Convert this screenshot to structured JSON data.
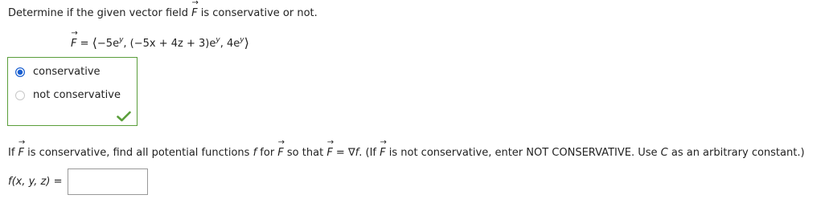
{
  "question": {
    "prefix": "Determine if the given vector field ",
    "vector_symbol": "F",
    "suffix": " is conservative or not."
  },
  "equation": {
    "lhs": "F",
    "equals": " = ",
    "open": "⟨",
    "term1_base": "−5e",
    "term1_exp": "y",
    "sep1": ", ",
    "term2_base": "(−5x + 4z + 3)e",
    "term2_exp": "y",
    "sep2": ", ",
    "term3_base": "4e",
    "term3_exp": "y",
    "close": "⟩"
  },
  "choices": [
    {
      "label": "conservative",
      "selected": true
    },
    {
      "label": "not conservative",
      "selected": false
    }
  ],
  "feedback": {
    "icon": "checkmark-icon",
    "color": "#5a9e3a"
  },
  "instruction": {
    "part1": "If ",
    "part2": " is conservative, find all potential functions ",
    "f1": "f",
    "part3": " for ",
    "part4": " so that ",
    "part5": " = ∇",
    "f2": "f",
    "part6": ". (If ",
    "part7": " is not conservative, enter NOT CONSERVATIVE. Use ",
    "c": "C",
    "part8": " as an arbitrary constant.)"
  },
  "answer": {
    "label": "f(x, y, z)",
    "equals": " =",
    "value": "",
    "placeholder": ""
  },
  "colors": {
    "accent": "#1a5fd0",
    "correct_border": "#5a9e3a"
  }
}
